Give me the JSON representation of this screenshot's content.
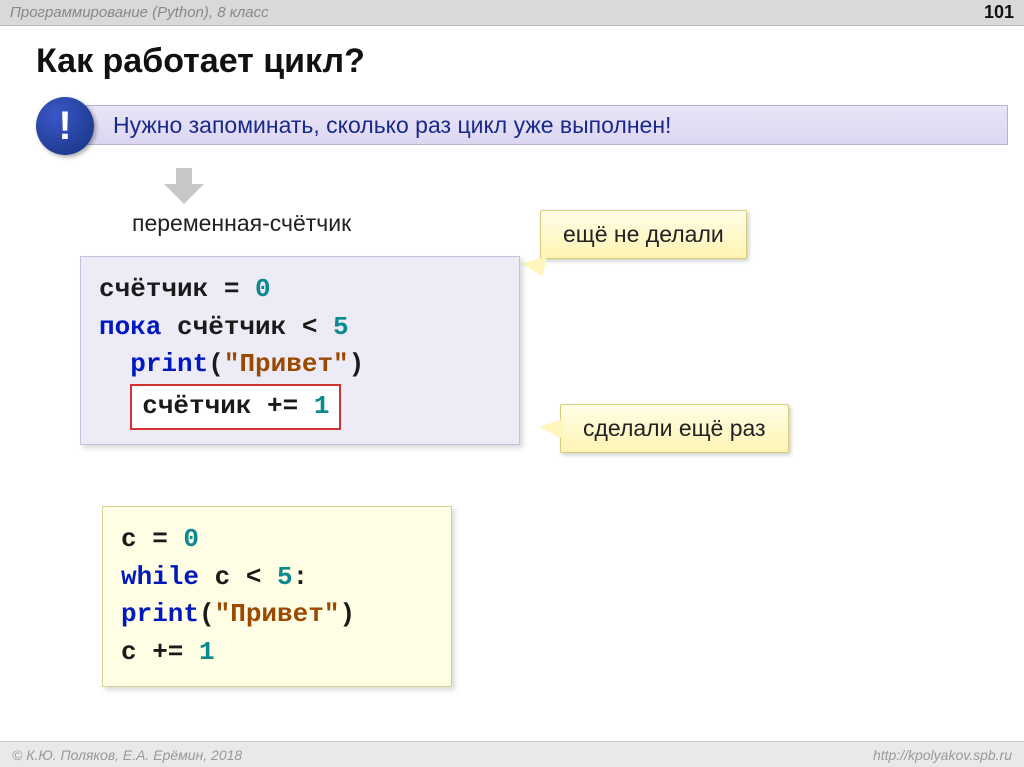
{
  "header": {
    "subject": "Программирование (Python), 8 класс",
    "page": "101"
  },
  "title": "Как работает цикл?",
  "banner": {
    "mark": "!",
    "text": "Нужно запоминать, сколько раз цикл уже выполнен!"
  },
  "caption_counter": "переменная-счётчик",
  "bubble_not_done": "ещё не делали",
  "bubble_done_again": "сделали ещё раз",
  "pseudo": {
    "l1a": "счётчик = ",
    "l1b": "0",
    "l2a": "пока ",
    "l2b": "счётчик < ",
    "l2c": "5",
    "l3a": "print",
    "l3b": "(",
    "l3c": "\"Привет\"",
    "l3d": ")",
    "l4a": "счётчик += ",
    "l4b": "1"
  },
  "python": {
    "l1a": "c = ",
    "l1b": "0",
    "l2a": "while",
    "l2b": " c < ",
    "l2c": "5",
    "l2d": ":",
    "l3a": " print",
    "l3b": "(",
    "l3c": "\"Привет\"",
    "l3d": ")",
    "l4a": " c += ",
    "l4b": "1"
  },
  "footer": {
    "left": "© К.Ю. Поляков, Е.А. Ерёмин, 2018",
    "right": "http://kpolyakov.spb.ru"
  }
}
